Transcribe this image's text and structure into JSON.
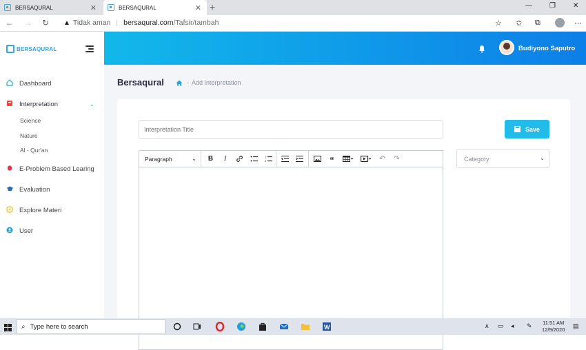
{
  "browser": {
    "tabs": [
      {
        "title": "BERSAQURAL",
        "active": false
      },
      {
        "title": "BERSAQURAL",
        "active": true
      }
    ],
    "address": {
      "security_label": "Tidak aman",
      "host": "bersaqural.com",
      "path": "/Tafsir/tambah"
    }
  },
  "sidebar": {
    "logo_text": "BERSAQURAL",
    "items": [
      {
        "label": "Dashboard",
        "icon": "home-icon"
      },
      {
        "label": "Interpretation",
        "icon": "book-icon",
        "expanded": true
      },
      {
        "label": "E-Problem Based Learing",
        "icon": "gem-icon"
      },
      {
        "label": "Evaluation",
        "icon": "graduation-cap-icon"
      },
      {
        "label": "Explore Materi",
        "icon": "compass-icon"
      },
      {
        "label": "User",
        "icon": "user-icon"
      }
    ],
    "subitems": [
      "Science",
      "Nature",
      "Al - Qur'an"
    ]
  },
  "header": {
    "username": "Budiyono Saputro",
    "gradient_start": "#12b8ea",
    "gradient_end": "#0d7fe8"
  },
  "page": {
    "title": "Bersaqural",
    "breadcrumb_sep": "-",
    "breadcrumb": "Add Interpretation"
  },
  "form": {
    "title_placeholder": "Interpretation Title",
    "save_label": "Save",
    "category_placeholder": "Category",
    "editor_format": "Paragraph",
    "accent_color": "#21bce9"
  },
  "taskbar": {
    "search_placeholder": "Type here to search",
    "time": "11:51 AM",
    "date": "12/9/2020"
  }
}
